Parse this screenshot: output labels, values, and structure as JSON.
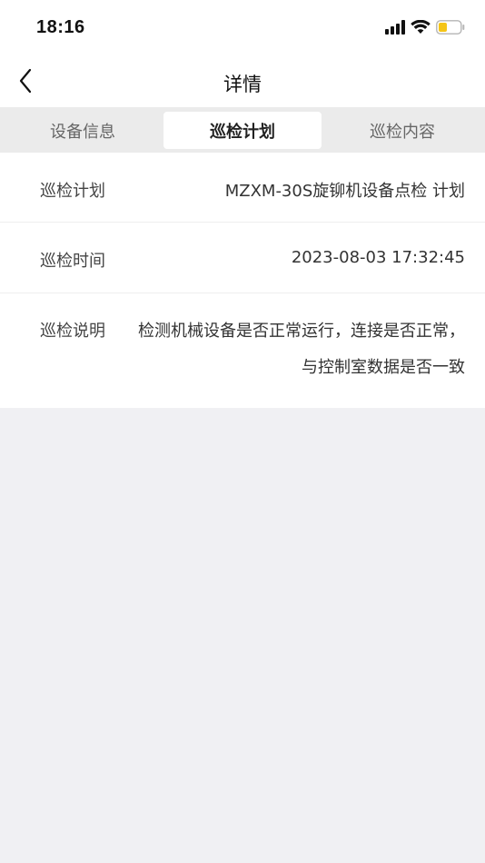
{
  "status_bar": {
    "time": "18:16",
    "battery_color": "#f5c518",
    "icons": [
      "cellular-signal-icon",
      "wifi-icon",
      "battery-icon"
    ]
  },
  "nav": {
    "title": "详情"
  },
  "tabs": [
    {
      "label": "设备信息",
      "active": false
    },
    {
      "label": "巡检计划",
      "active": true
    },
    {
      "label": "巡检内容",
      "active": false
    }
  ],
  "details": {
    "plan": {
      "label": "巡检计划",
      "value": "MZXM-30S旋铆机设备点检 计划"
    },
    "time": {
      "label": "巡检时间",
      "value": "2023-08-03 17:32:45"
    },
    "description": {
      "label": "巡检说明",
      "value": "检测机械设备是否正常运行，连接是否正常，与控制室数据是否一致"
    }
  }
}
